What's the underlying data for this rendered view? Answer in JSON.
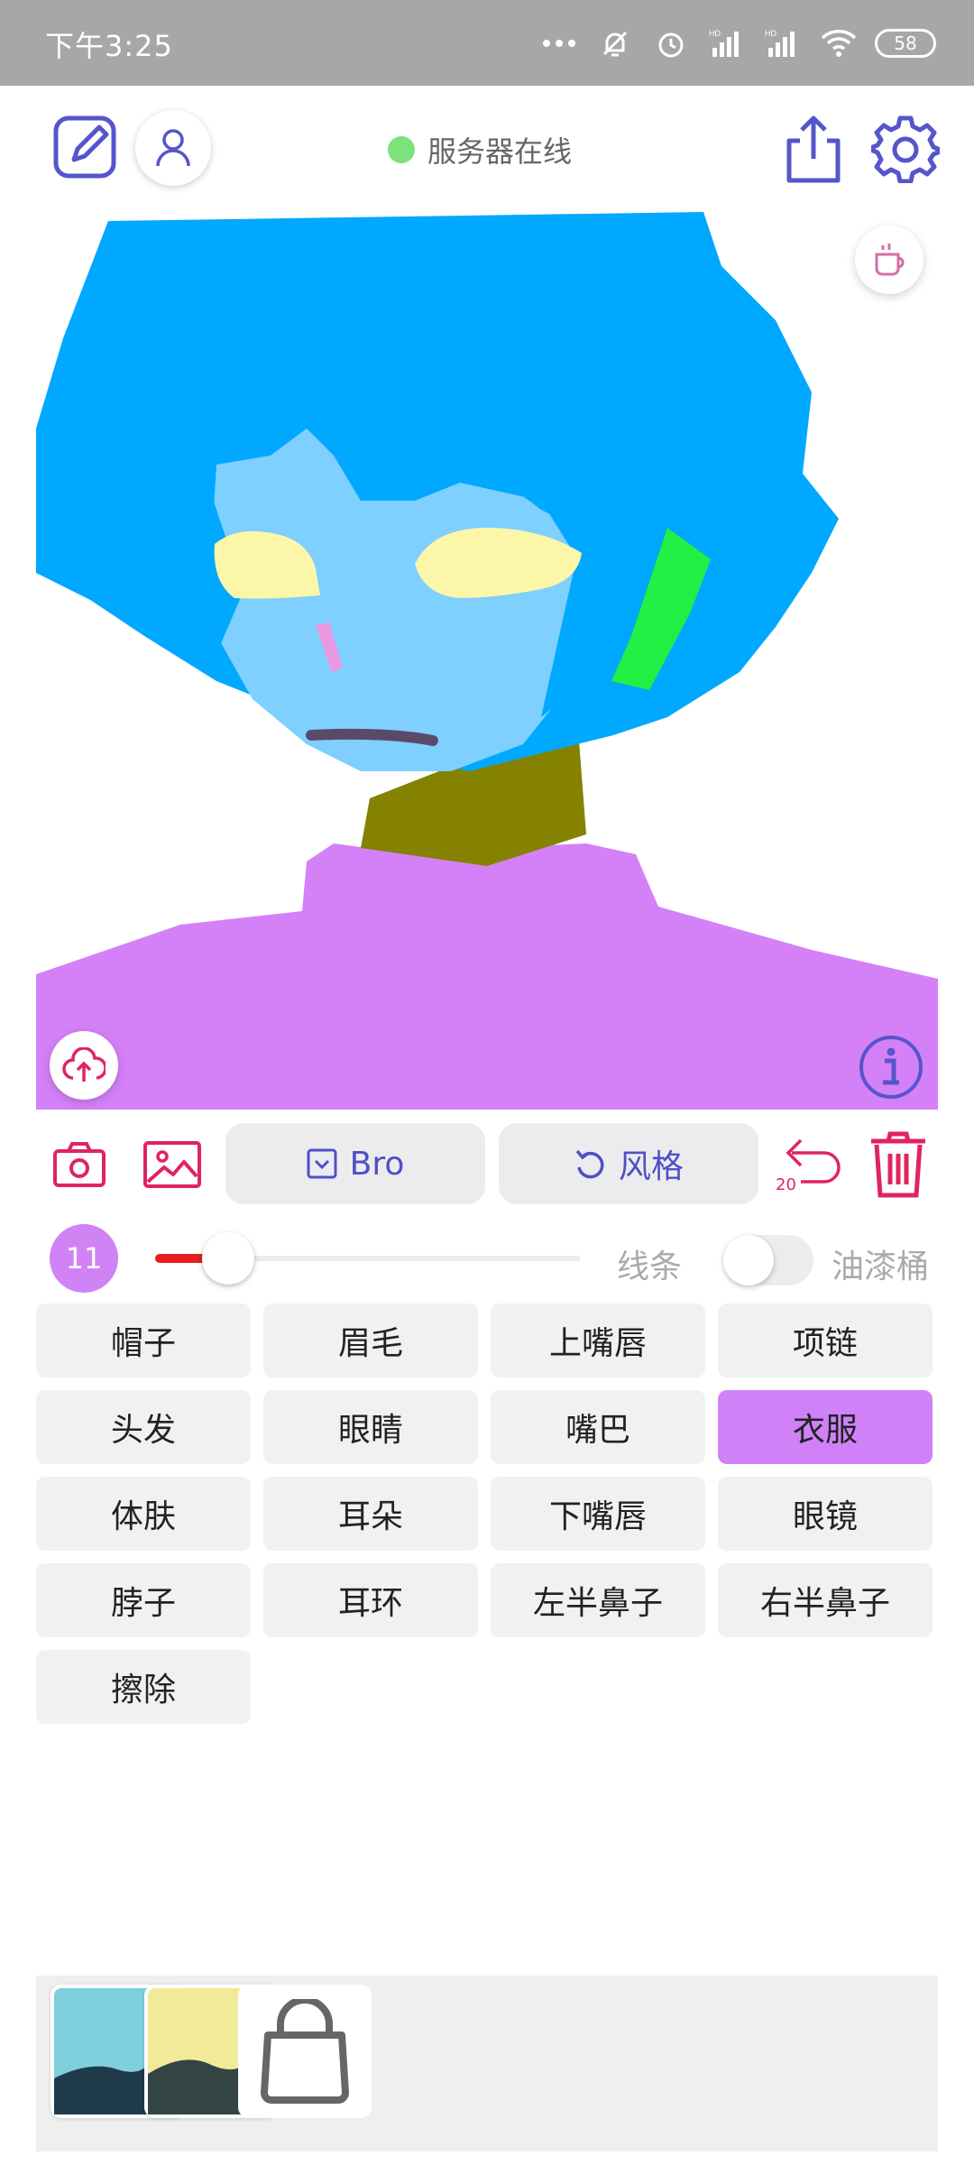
{
  "status_bar": {
    "time": "下午3:25",
    "battery": "58",
    "icons": [
      "more-dots-icon",
      "bell-off-icon",
      "alarm-icon",
      "signal-hd-icon",
      "signal-hd-icon",
      "wifi-icon",
      "battery-icon"
    ]
  },
  "header": {
    "server_status": "服务器在线",
    "server_status_color": "#7ee27a",
    "accent": "#5555cc"
  },
  "toolbar": {
    "brush_label": "Bro",
    "style_label": "风格",
    "undo_count": "20",
    "camera_color": "#e0245e"
  },
  "slider": {
    "size_value": "11",
    "line_label": "线条",
    "bucket_label": "油漆桶",
    "line_width_fraction": 0.12,
    "bucket_enabled": false
  },
  "categories": [
    {
      "label": "帽子",
      "active": false
    },
    {
      "label": "眉毛",
      "active": false
    },
    {
      "label": "上嘴唇",
      "active": false
    },
    {
      "label": "项链",
      "active": false
    },
    {
      "label": "头发",
      "active": false
    },
    {
      "label": "眼睛",
      "active": false
    },
    {
      "label": "嘴巴",
      "active": false
    },
    {
      "label": "衣服",
      "active": true
    },
    {
      "label": "体肤",
      "active": false
    },
    {
      "label": "耳朵",
      "active": false
    },
    {
      "label": "下嘴唇",
      "active": false
    },
    {
      "label": "眼镜",
      "active": false
    },
    {
      "label": "脖子",
      "active": false
    },
    {
      "label": "耳环",
      "active": false
    },
    {
      "label": "左半鼻子",
      "active": false
    },
    {
      "label": "右半鼻子",
      "active": false
    },
    {
      "label": "擦除",
      "active": false
    }
  ],
  "palette": {
    "hair": "#00a8ff",
    "skin": "#7fcfff",
    "eyes": "#fcf6a8",
    "neck": "#848200",
    "clothes": "#d481f8",
    "earring": "#22ee44",
    "nose": "#ec98e0",
    "mouth": "#5a4a6a"
  }
}
